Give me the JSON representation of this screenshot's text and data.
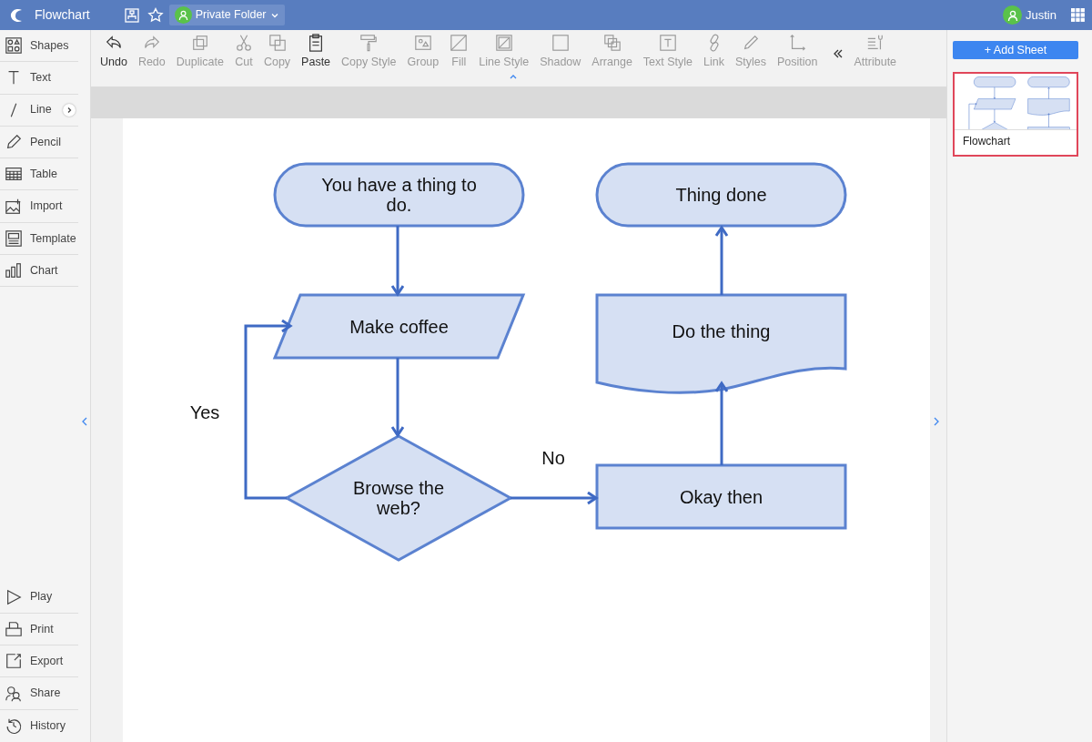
{
  "app": {
    "title": "Flowchart",
    "folder": "Private Folder",
    "user": "Justin"
  },
  "sidebar": {
    "tools": [
      {
        "label": "Shapes",
        "expandable": false
      },
      {
        "label": "Text",
        "expandable": false
      },
      {
        "label": "Line",
        "expandable": true
      },
      {
        "label": "Pencil",
        "expandable": false
      },
      {
        "label": "Table",
        "expandable": false
      },
      {
        "label": "Import",
        "expandable": false
      },
      {
        "label": "Template",
        "expandable": false
      },
      {
        "label": "Chart",
        "expandable": false
      }
    ],
    "actions": [
      {
        "label": "Play"
      },
      {
        "label": "Print"
      },
      {
        "label": "Export"
      },
      {
        "label": "Share"
      },
      {
        "label": "History"
      }
    ]
  },
  "toolbar": [
    {
      "label": "Undo",
      "disabled": false
    },
    {
      "label": "Redo",
      "disabled": true
    },
    {
      "label": "Duplicate",
      "disabled": true
    },
    {
      "label": "Cut",
      "disabled": true
    },
    {
      "label": "Copy",
      "disabled": true
    },
    {
      "label": "Paste",
      "disabled": false
    },
    {
      "label": "Copy Style",
      "disabled": true
    },
    {
      "label": "Group",
      "disabled": true
    },
    {
      "label": "Fill",
      "disabled": true
    },
    {
      "label": "Line Style",
      "disabled": true
    },
    {
      "label": "Shadow",
      "disabled": true
    },
    {
      "label": "Arrange",
      "disabled": true
    },
    {
      "label": "Text Style",
      "disabled": true
    },
    {
      "label": "Link",
      "disabled": true
    },
    {
      "label": "Styles",
      "disabled": true
    },
    {
      "label": "Position",
      "disabled": true
    },
    {
      "label": "Attribute",
      "disabled": true
    }
  ],
  "sheets": {
    "add_button": "+ Add Sheet",
    "items": [
      {
        "label": "Flowchart",
        "selected": true
      }
    ]
  },
  "diagram": {
    "nodes": [
      {
        "kind": "terminal",
        "label": "You have a thing to do."
      },
      {
        "kind": "data",
        "label": "Make coffee"
      },
      {
        "kind": "decision",
        "label": "Browse the web?"
      },
      {
        "kind": "terminal",
        "label": "Thing done"
      },
      {
        "kind": "document",
        "label": "Do the thing"
      },
      {
        "kind": "process",
        "label": "Okay then"
      }
    ],
    "edge_labels": [
      "Yes",
      "No"
    ]
  }
}
